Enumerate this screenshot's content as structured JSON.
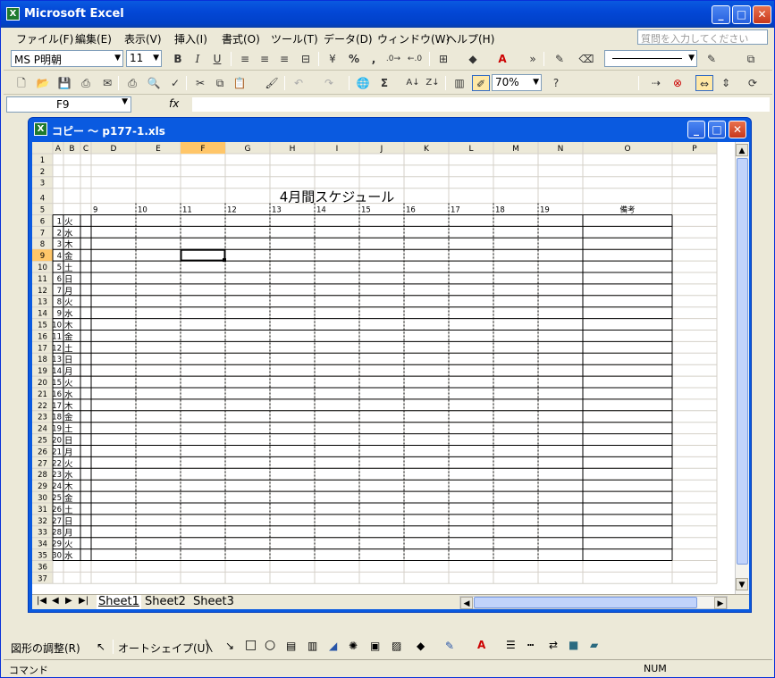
{
  "app": {
    "title": "Microsoft Excel",
    "icon": "excel-icon"
  },
  "menu": [
    "ファイル(F)",
    "編集(E)",
    "表示(V)",
    "挿入(I)",
    "書式(O)",
    "ツール(T)",
    "データ(D)",
    "ウィンドウ(W)",
    "ヘルプ(H)"
  ],
  "help_placeholder": "質問を入力してください",
  "format_toolbar": {
    "font": "MS P明朝",
    "size": "11",
    "bold": "B",
    "italic": "I",
    "underline": "U",
    "percent": "%",
    "comma": ","
  },
  "standard_toolbar": {
    "sigma": "Σ",
    "zoom": "70%"
  },
  "formula_bar": {
    "name_box": "F9",
    "fx": "fx",
    "value": ""
  },
  "workbook": {
    "title": "コピー ～ p177-1.xls",
    "icon": "excel-file-icon"
  },
  "sheet": {
    "col_headers": [
      "A",
      "B",
      "C",
      "D",
      "E",
      "F",
      "G",
      "H",
      "I",
      "J",
      "K",
      "L",
      "M",
      "N",
      "O",
      "P"
    ],
    "row_headers": [
      "1",
      "2",
      "3",
      "4",
      "5",
      "6",
      "7",
      "8",
      "9",
      "10",
      "11",
      "12",
      "13",
      "14",
      "15",
      "16",
      "17",
      "18",
      "19",
      "20",
      "21",
      "22",
      "23",
      "24",
      "25",
      "26",
      "27",
      "28",
      "29",
      "30",
      "31",
      "32",
      "33",
      "34",
      "35",
      "36",
      "37"
    ],
    "title": "4月間スケジュール",
    "hours": [
      "9",
      "10",
      "11",
      "12",
      "13",
      "14",
      "15",
      "16",
      "17",
      "18",
      "19"
    ],
    "notes_header": "備考",
    "days": [
      "1",
      "2",
      "3",
      "4",
      "5",
      "6",
      "7",
      "8",
      "9",
      "10",
      "11",
      "12",
      "13",
      "14",
      "15",
      "16",
      "17",
      "18",
      "19",
      "20",
      "21",
      "22",
      "23",
      "24",
      "25",
      "26",
      "27",
      "28",
      "29",
      "30"
    ],
    "weekdays": [
      "火",
      "水",
      "木",
      "金",
      "土",
      "日",
      "月",
      "火",
      "水",
      "木",
      "金",
      "土",
      "日",
      "月",
      "火",
      "水",
      "木",
      "金",
      "土",
      "日",
      "月",
      "火",
      "水",
      "木",
      "金",
      "土",
      "日",
      "月",
      "火",
      "水"
    ],
    "active_cell": "F9"
  },
  "tabs": [
    "Sheet1",
    "Sheet2",
    "Sheet3"
  ],
  "active_tab": "Sheet1",
  "drawing_toolbar": {
    "adjust": "図形の調整(R)",
    "autoshape": "オートシェイプ(U)"
  },
  "status": {
    "mode": "コマンド",
    "num": "NUM"
  },
  "colors": {
    "titlebar": "#0a5ae0",
    "header_bg": "#ece9d8",
    "active_header": "#ffc669"
  }
}
